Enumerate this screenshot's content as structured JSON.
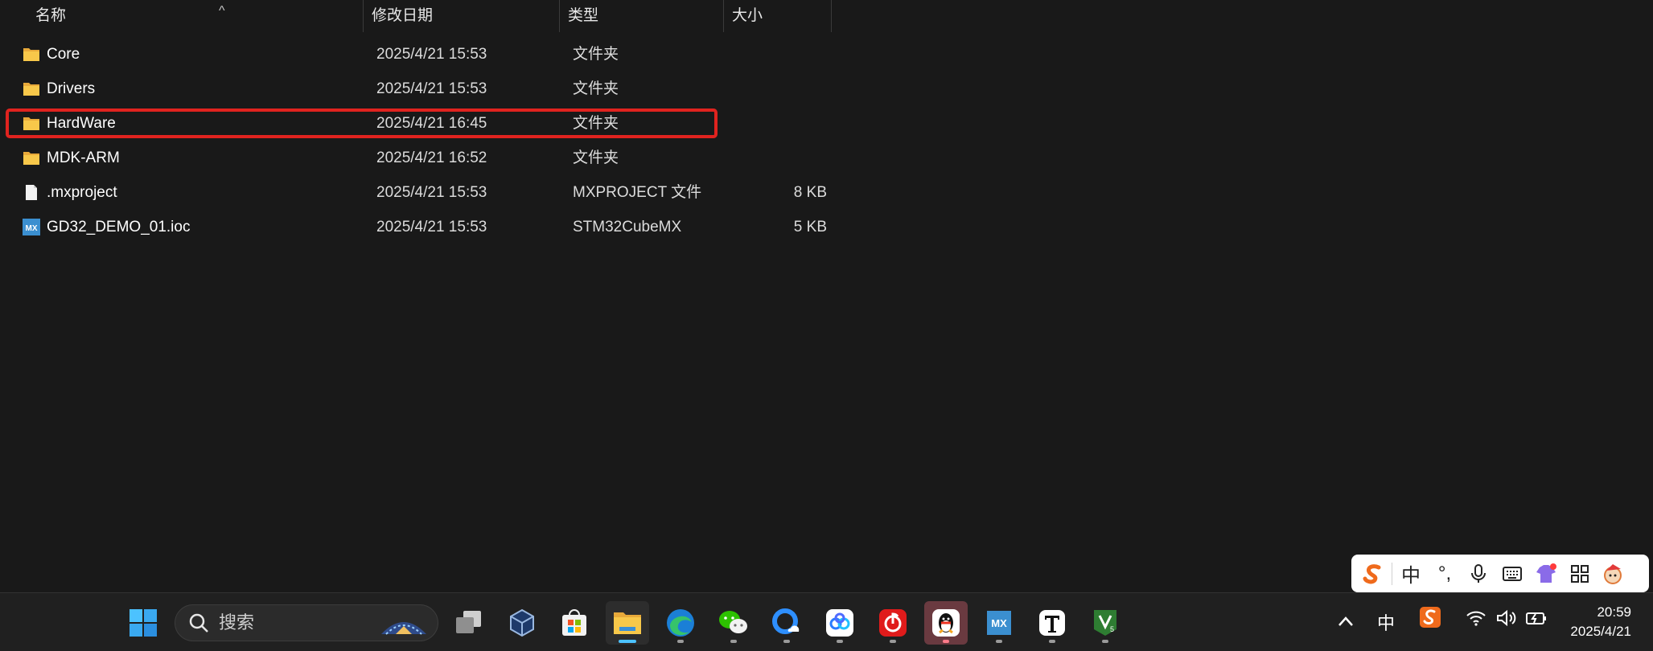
{
  "columns": {
    "name": "名称",
    "modified": "修改日期",
    "type": "类型",
    "size": "大小"
  },
  "files": [
    {
      "name": "Core",
      "modified": "2025/4/21 15:53",
      "type": "文件夹",
      "size": "",
      "icon": "folder-icon"
    },
    {
      "name": "Drivers",
      "modified": "2025/4/21 15:53",
      "type": "文件夹",
      "size": "",
      "icon": "folder-icon"
    },
    {
      "name": "HardWare",
      "modified": "2025/4/21 16:45",
      "type": "文件夹",
      "size": "",
      "icon": "folder-icon",
      "highlighted": true
    },
    {
      "name": "MDK-ARM",
      "modified": "2025/4/21 16:52",
      "type": "文件夹",
      "size": "",
      "icon": "folder-icon"
    },
    {
      "name": ".mxproject",
      "modified": "2025/4/21 15:53",
      "type": "MXPROJECT 文件",
      "size": "8 KB",
      "icon": "file-icon"
    },
    {
      "name": "GD32_DEMO_01.ioc",
      "modified": "2025/4/21 15:53",
      "type": "STM32CubeMX",
      "size": "5 KB",
      "icon": "stm32cubemx-icon"
    }
  ],
  "highlight_color": "#e0231f",
  "ime_toolbar": {
    "logo_icon": "sogou-logo-icon",
    "mode_label": "中",
    "punct_label": "°,"
  },
  "taskbar": {
    "search_placeholder": "搜索",
    "mx_label": "MX",
    "tray_language": "中",
    "clock_time": "20:59",
    "clock_date": "2025/4/21"
  }
}
